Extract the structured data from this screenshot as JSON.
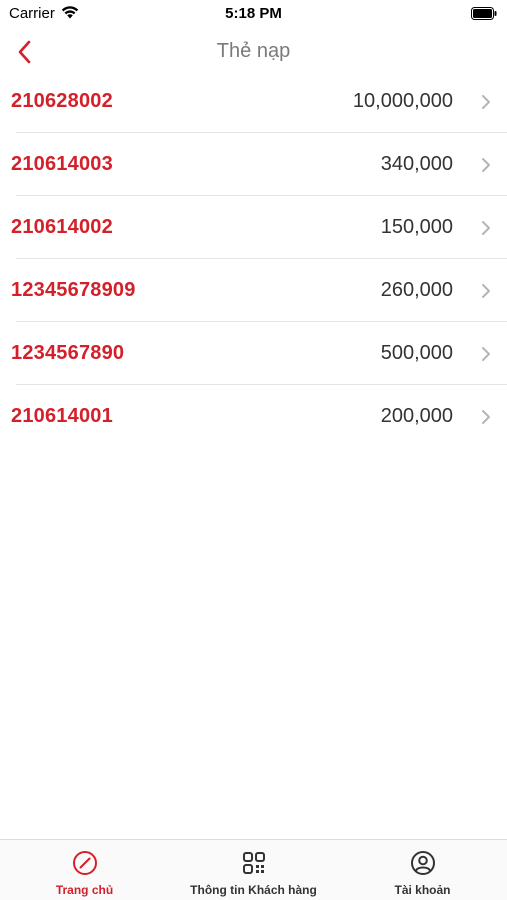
{
  "status_bar": {
    "carrier": "Carrier",
    "time": "5:18 PM"
  },
  "nav": {
    "title": "Thẻ nạp"
  },
  "list": [
    {
      "code": "210628002",
      "amount": "10,000,000"
    },
    {
      "code": "210614003",
      "amount": "340,000"
    },
    {
      "code": "210614002",
      "amount": "150,000"
    },
    {
      "code": "12345678909",
      "amount": "260,000"
    },
    {
      "code": "1234567890",
      "amount": "500,000"
    },
    {
      "code": "210614001",
      "amount": "200,000"
    }
  ],
  "tabs": [
    {
      "label": "Trang chủ",
      "icon": "compass-icon",
      "active": true
    },
    {
      "label": "Thông tin Khách hàng",
      "icon": "qr-code-icon",
      "active": false
    },
    {
      "label": "Tài khoản",
      "icon": "user-circle-icon",
      "active": false
    }
  ],
  "colors": {
    "accent": "#d4202a",
    "title_gray": "#7a7a7a",
    "separator": "#e4e4e4"
  }
}
